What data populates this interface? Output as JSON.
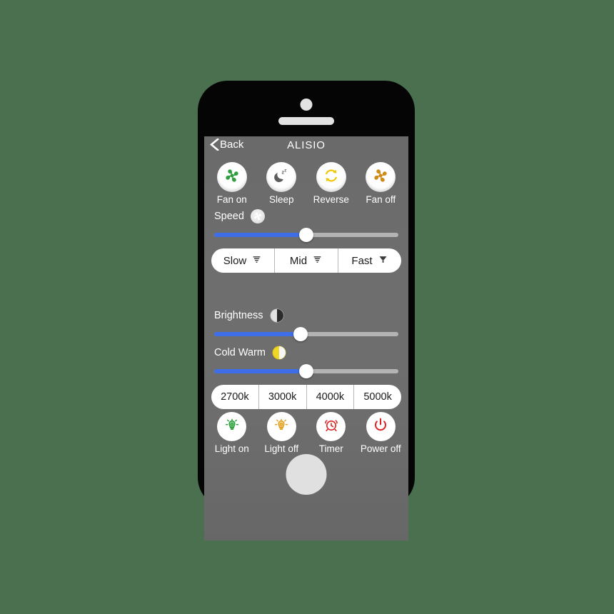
{
  "background_color": "#4a7050",
  "device": {
    "name": "smartphone-mockup",
    "frame_color": "#050505",
    "screen_bg": "#6c6c6c"
  },
  "navbar": {
    "back_label": "Back",
    "title": "ALISIO"
  },
  "fan_controls": [
    {
      "label": "Fan on",
      "icon": "fan-icon",
      "color": "#2f9e3e"
    },
    {
      "label": "Sleep",
      "icon": "moon-zzz-icon",
      "color": "#5d5d5d"
    },
    {
      "label": "Reverse",
      "icon": "refresh-icon",
      "color": "#f2c500"
    },
    {
      "label": "Fan off",
      "icon": "fan-icon",
      "color": "#cf8a18"
    }
  ],
  "speed": {
    "label": "Speed",
    "icon": "fan-icon",
    "slider_value": 50,
    "fill_color": "#3d6ee8",
    "track_color": "#b4b4b4"
  },
  "speed_segments": [
    {
      "label": "Slow",
      "icon": "tornado-icon"
    },
    {
      "label": "Mid",
      "icon": "tornado-icon"
    },
    {
      "label": "Fast",
      "icon": "tornado-icon"
    }
  ],
  "brightness": {
    "label": "Brightness",
    "icon": "half-circle-icon",
    "icon_color": "#d9d9d9",
    "slider_value": 47
  },
  "cold_warm": {
    "label": "Cold Warm",
    "icon": "half-circle-icon",
    "icon_color": "#efd726",
    "slider_value": 50
  },
  "color_temperatures": [
    {
      "label": "2700k"
    },
    {
      "label": "3000k"
    },
    {
      "label": "4000k"
    },
    {
      "label": "5000k"
    }
  ],
  "light_controls": [
    {
      "label": "Light on",
      "icon": "bulb-icon",
      "color": "#2f9e3e"
    },
    {
      "label": "Light off",
      "icon": "bulb-icon",
      "color": "#e0a020"
    },
    {
      "label": "Timer",
      "icon": "alarm-icon",
      "color": "#dd2222"
    },
    {
      "label": "Power off",
      "icon": "power-icon",
      "color": "#dd2222"
    }
  ]
}
